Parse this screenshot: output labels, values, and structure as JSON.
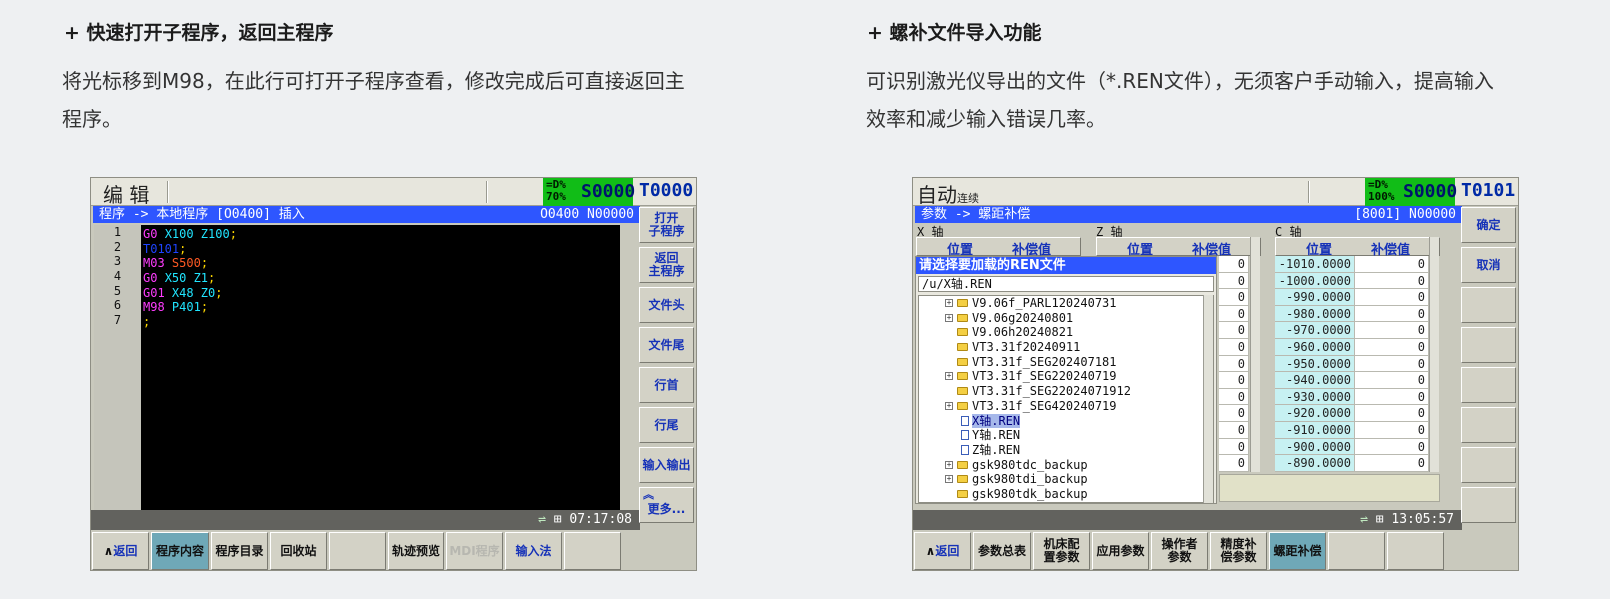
{
  "left_feature": {
    "title": "+ 快速打开子程序，返回主程序",
    "desc_line1": "将光标移到M98，在此行可打开子程序查看，修改完成后可直接返回主",
    "desc_line2": "程序。"
  },
  "right_feature": {
    "title": "+ 螺补文件导入功能",
    "desc_line1": "可识别激光仪导出的文件（*.REN文件），无须客户手动输入，提高输入",
    "desc_line2": "效率和减少输入错误几率。"
  },
  "screen1": {
    "mode": "编 辑",
    "pct_top": "=D%",
    "pct_bottom": "70%",
    "spindle": "S0000",
    "tool": "T0000",
    "path": "程序 -> 本地程序 [O0400]  插入",
    "path_right": "O0400 N00000",
    "line_numbers": [
      "1",
      "2",
      "3",
      "4",
      "5",
      "6",
      "7"
    ],
    "code_lines": [
      [
        {
          "t": "G0 ",
          "c": "#ff3cff"
        },
        {
          "t": "X100 Z100",
          "c": "#21e5ff"
        },
        {
          "t": ";",
          "c": "#ffd900"
        }
      ],
      [
        {
          "t": "T0101",
          "c": "#1e44ff"
        },
        {
          "t": ";",
          "c": "#ffd900"
        }
      ],
      [
        {
          "t": "M03 ",
          "c": "#ff3cff"
        },
        {
          "t": "S500",
          "c": "#ff5a24"
        },
        {
          "t": ";",
          "c": "#ffd900"
        }
      ],
      [
        {
          "t": "G0 ",
          "c": "#ff3cff"
        },
        {
          "t": "X50 Z1",
          "c": "#21e5ff"
        },
        {
          "t": ";",
          "c": "#ffd900"
        }
      ],
      [
        {
          "t": "G01 ",
          "c": "#ff3cff"
        },
        {
          "t": "X48 Z0",
          "c": "#21e5ff"
        },
        {
          "t": ";",
          "c": "#ffd900"
        }
      ],
      [
        {
          "t": "M98 ",
          "c": "#ff3cff"
        },
        {
          "t": "P401",
          "c": "#21e5ff"
        },
        {
          "t": ";",
          "c": "#ffd900"
        }
      ],
      [
        {
          "t": ";",
          "c": "#ffd900"
        }
      ]
    ],
    "time": "07:17:08",
    "side_buttons": [
      "打开\n子程序",
      "返回\n主程序",
      "文件头",
      "文件尾",
      "行首",
      "行尾",
      "输入输出",
      "更多..."
    ],
    "bottom_buttons": [
      "返回",
      "程序内容",
      "程序目录",
      "回收站",
      "",
      "轨迹预览",
      "MDI程序",
      "输入法",
      ""
    ]
  },
  "screen2": {
    "mode": "自动",
    "mode_sub": "连续",
    "pct_top": "=D%",
    "pct_bottom": "100%",
    "spindle": "S0000",
    "tool": "T0101",
    "path": "参数 -> 螺距补偿",
    "path_right": "[8001] N00000",
    "axis_x": "X 轴",
    "axis_z": "Z 轴",
    "axis_c": "C 轴",
    "col_pos": "位置",
    "col_comp": "补偿值",
    "dialog_title": "请选择要加载的REN文件",
    "dialog_path": "/u/X轴.REN",
    "tree": [
      {
        "label": "V9.06f_PARL120240731",
        "type": "folder",
        "exp": "+"
      },
      {
        "label": "V9.06g20240801",
        "type": "folder",
        "exp": "+"
      },
      {
        "label": "V9.06h20240821",
        "type": "folder",
        "exp": ""
      },
      {
        "label": "VT3.31f20240911",
        "type": "folder",
        "exp": ""
      },
      {
        "label": "VT3.31f_SEG202407181",
        "type": "folder",
        "exp": ""
      },
      {
        "label": "VT3.31f_SEG220240719",
        "type": "folder",
        "exp": "+"
      },
      {
        "label": "VT3.31f_SEG22024071912",
        "type": "folder",
        "exp": ""
      },
      {
        "label": "VT3.31f_SEG420240719",
        "type": "folder",
        "exp": "+"
      },
      {
        "label": "X轴.REN",
        "type": "file",
        "exp": "",
        "selected": true
      },
      {
        "label": "Y轴.REN",
        "type": "file",
        "exp": ""
      },
      {
        "label": "Z轴.REN",
        "type": "file",
        "exp": ""
      },
      {
        "label": "gsk980tdc_backup",
        "type": "folder",
        "exp": "+"
      },
      {
        "label": "gsk980tdi_backup",
        "type": "folder",
        "exp": "+"
      },
      {
        "label": "gsk980tdk_backup",
        "type": "folder",
        "exp": ""
      }
    ],
    "z_comp_values": [
      "0",
      "0",
      "0",
      "0",
      "0",
      "0",
      "0",
      "0",
      "0",
      "0",
      "0",
      "0",
      "0"
    ],
    "c_rows": [
      {
        "pos": "-1010.0000",
        "comp": "0"
      },
      {
        "pos": "-1000.0000",
        "comp": "0"
      },
      {
        "pos": "-990.0000",
        "comp": "0"
      },
      {
        "pos": "-980.0000",
        "comp": "0"
      },
      {
        "pos": "-970.0000",
        "comp": "0"
      },
      {
        "pos": "-960.0000",
        "comp": "0"
      },
      {
        "pos": "-950.0000",
        "comp": "0"
      },
      {
        "pos": "-940.0000",
        "comp": "0"
      },
      {
        "pos": "-930.0000",
        "comp": "0"
      },
      {
        "pos": "-920.0000",
        "comp": "0"
      },
      {
        "pos": "-910.0000",
        "comp": "0"
      },
      {
        "pos": "-900.0000",
        "comp": "0"
      },
      {
        "pos": "-890.0000",
        "comp": "0"
      }
    ],
    "time": "13:05:57",
    "side_buttons": [
      "确定",
      "取消",
      "",
      "",
      "",
      "",
      "",
      ""
    ],
    "bottom_buttons": [
      "返回",
      "参数总表",
      "机床配\n置参数",
      "应用参数",
      "操作者\n参数",
      "精度补\n偿参数",
      "螺距补偿",
      "",
      ""
    ]
  }
}
